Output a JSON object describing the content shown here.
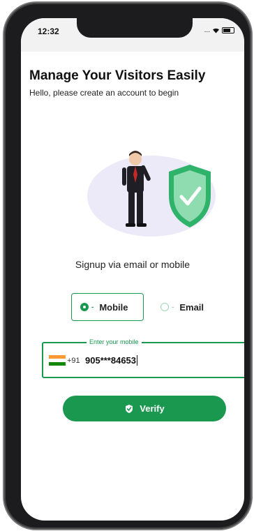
{
  "status_bar": {
    "time": "12:32",
    "signal": "...",
    "wifi": "wifi-icon",
    "battery": "battery-icon"
  },
  "header": {
    "title": "Manage Your Visitors Easily",
    "subtitle": "Hello, please create an account to begin"
  },
  "illustration": {
    "icon": "businessman-shield-illustration"
  },
  "signup": {
    "prompt": "Signup via email or mobile",
    "options": [
      {
        "label": "Mobile",
        "selected": true
      },
      {
        "label": "Email",
        "selected": false
      }
    ]
  },
  "mobile_input": {
    "label": "Enter your mobile",
    "country_code": "+91",
    "flag": "india-flag-icon",
    "value": "905***84653"
  },
  "verify_button": {
    "label": "Verify",
    "icon": "shield-check-icon"
  },
  "colors": {
    "accent": "#1a9850",
    "light_accent": "#9fd6b3"
  }
}
